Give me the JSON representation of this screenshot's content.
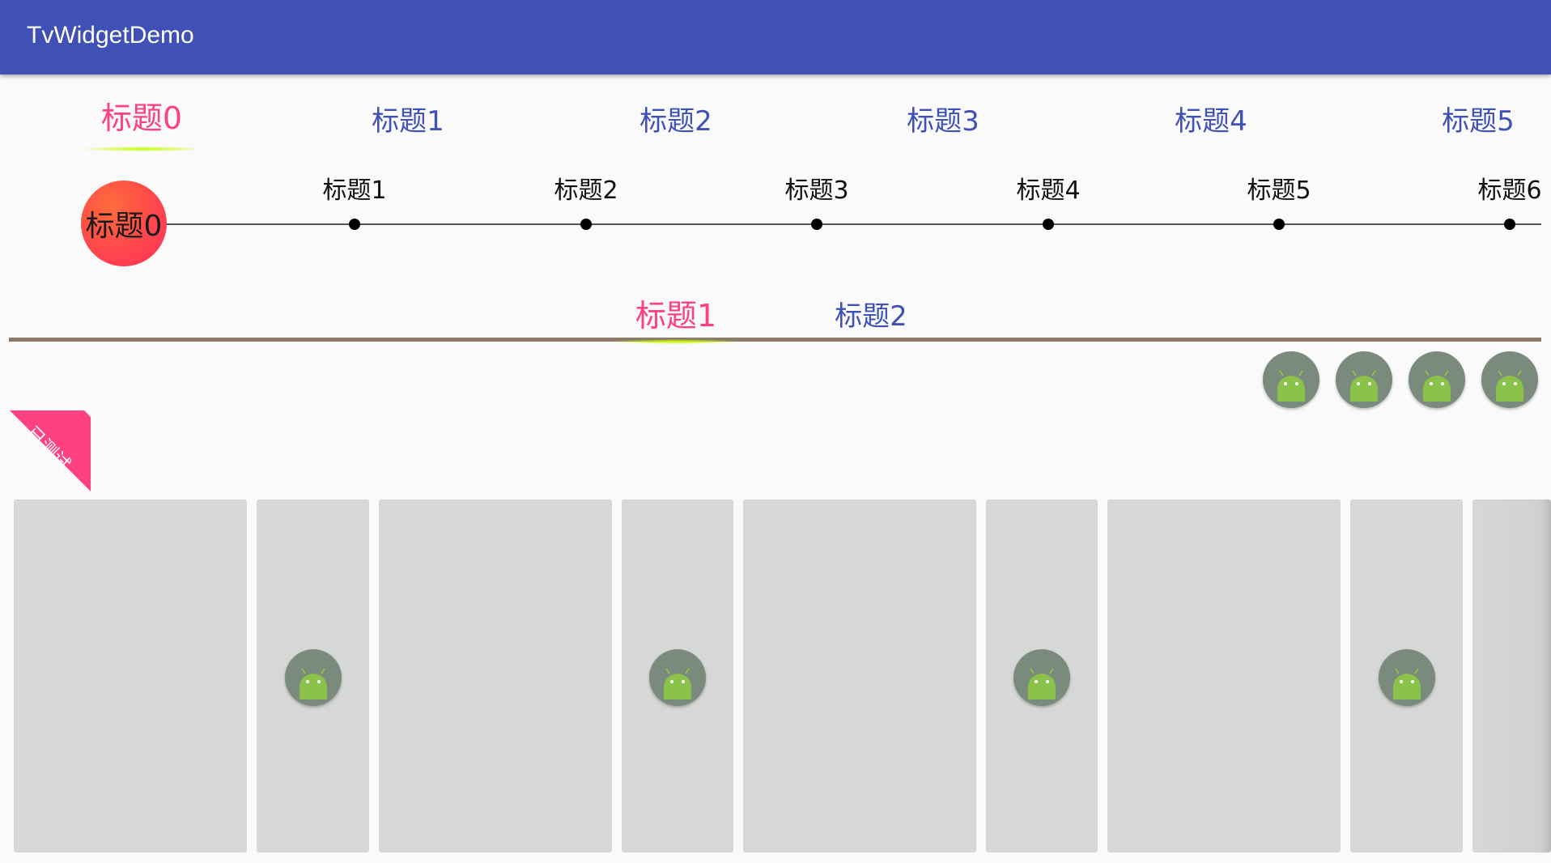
{
  "app_bar": {
    "title": "TvWidgetDemo"
  },
  "top_tabs": {
    "items": [
      {
        "label": "标题0",
        "active": true
      },
      {
        "label": "标题1"
      },
      {
        "label": "标题2"
      },
      {
        "label": "标题3"
      },
      {
        "label": "标题4"
      },
      {
        "label": "标题5"
      }
    ]
  },
  "timeline": {
    "current": "标题0",
    "items": [
      {
        "label": "标题1"
      },
      {
        "label": "标题2"
      },
      {
        "label": "标题3"
      },
      {
        "label": "标题4"
      },
      {
        "label": "标题5"
      },
      {
        "label": "标题6"
      }
    ]
  },
  "second_tabs": {
    "items": [
      {
        "label": "标题1",
        "active": true
      },
      {
        "label": "标题2"
      }
    ]
  },
  "badge": {
    "label": "已测试"
  },
  "icons": {
    "round_icon": "android-icon"
  },
  "colors": {
    "app_bar": "#3f51b5",
    "tab_inactive": "#3f51b5",
    "tab_active": "#ff4081",
    "underline": "#c6ff00",
    "badge": "#ff4081",
    "divider": "#8d7b68",
    "card": "#d6d8d7"
  }
}
